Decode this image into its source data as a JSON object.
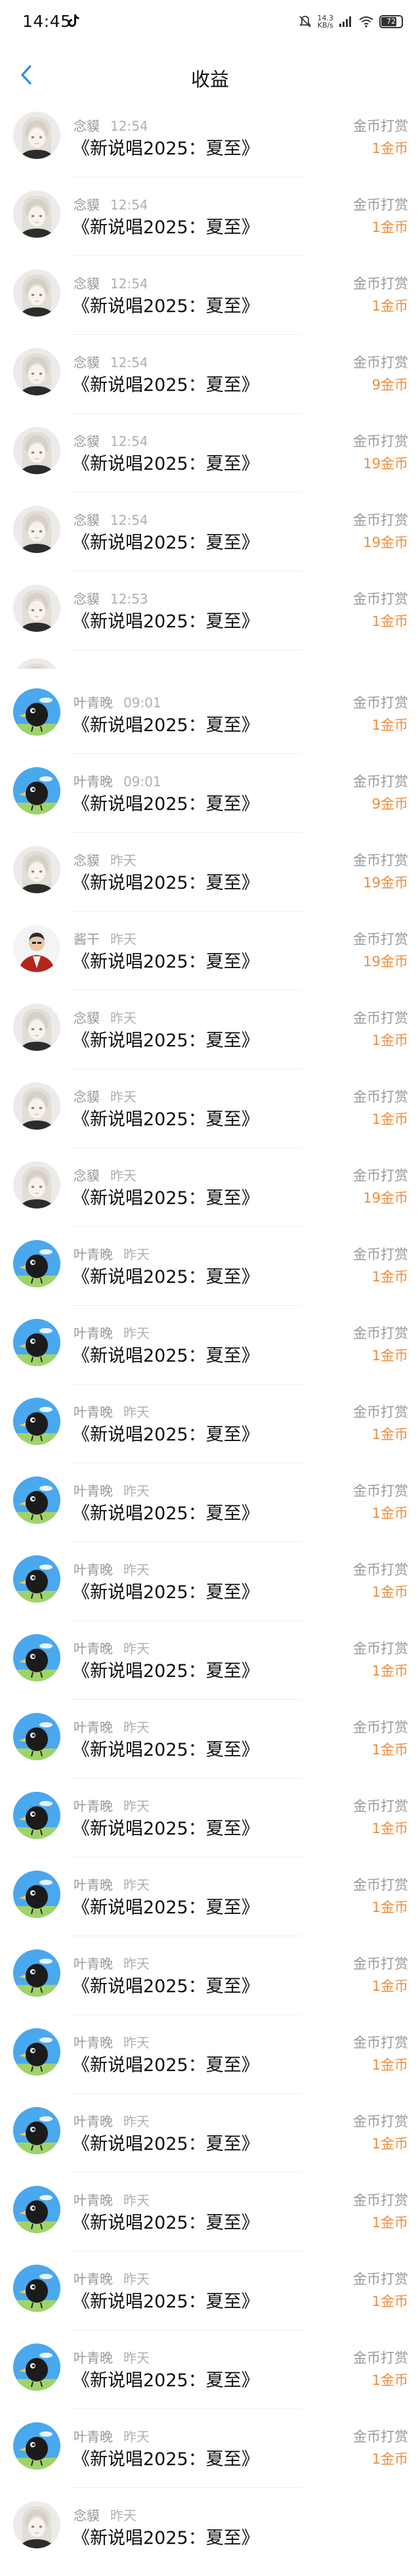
{
  "status_bar": {
    "time": "14:45",
    "net_speed": "14.3",
    "net_unit": "KB/s",
    "battery": "72"
  },
  "nav": {
    "title": "收益"
  },
  "records": [
    {
      "user": "念貘",
      "time": "12:54",
      "title": "《新说唱2025：夏至》",
      "type": "金币打赏",
      "amount": "1金币",
      "avatar": "anime"
    },
    {
      "user": "念貘",
      "time": "12:54",
      "title": "《新说唱2025：夏至》",
      "type": "金币打赏",
      "amount": "1金币",
      "avatar": "anime"
    },
    {
      "user": "念貘",
      "time": "12:54",
      "title": "《新说唱2025：夏至》",
      "type": "金币打赏",
      "amount": "1金币",
      "avatar": "anime"
    },
    {
      "user": "念貘",
      "time": "12:54",
      "title": "《新说唱2025：夏至》",
      "type": "金币打赏",
      "amount": "9金币",
      "avatar": "anime"
    },
    {
      "user": "念貘",
      "time": "12:54",
      "title": "《新说唱2025：夏至》",
      "type": "金币打赏",
      "amount": "19金币",
      "avatar": "anime"
    },
    {
      "user": "念貘",
      "time": "12:54",
      "title": "《新说唱2025：夏至》",
      "type": "金币打赏",
      "amount": "19金币",
      "avatar": "anime"
    },
    {
      "user": "念貘",
      "time": "12:53",
      "title": "《新说唱2025：夏至》",
      "type": "金币打赏",
      "amount": "1金币",
      "avatar": "anime"
    },
    {
      "user": "叶青晚",
      "time": "09:01",
      "title": "《新说唱2025：夏至》",
      "type": "金币打赏",
      "amount": "1金币",
      "avatar": "bird"
    },
    {
      "user": "叶青晚",
      "time": "09:01",
      "title": "《新说唱2025：夏至》",
      "type": "金币打赏",
      "amount": "9金币",
      "avatar": "bird"
    },
    {
      "user": "念貘",
      "time": "昨天",
      "title": "《新说唱2025：夏至》",
      "type": "金币打赏",
      "amount": "19金币",
      "avatar": "anime"
    },
    {
      "user": "酱干",
      "time": "昨天",
      "title": "《新说唱2025：夏至》",
      "type": "金币打赏",
      "amount": "19金币",
      "avatar": "person"
    },
    {
      "user": "念貘",
      "time": "昨天",
      "title": "《新说唱2025：夏至》",
      "type": "金币打赏",
      "amount": "1金币",
      "avatar": "anime"
    },
    {
      "user": "念貘",
      "time": "昨天",
      "title": "《新说唱2025：夏至》",
      "type": "金币打赏",
      "amount": "1金币",
      "avatar": "anime"
    },
    {
      "user": "念貘",
      "time": "昨天",
      "title": "《新说唱2025：夏至》",
      "type": "金币打赏",
      "amount": "19金币",
      "avatar": "anime"
    },
    {
      "user": "叶青晚",
      "time": "昨天",
      "title": "《新说唱2025：夏至》",
      "type": "金币打赏",
      "amount": "1金币",
      "avatar": "bird"
    },
    {
      "user": "叶青晚",
      "time": "昨天",
      "title": "《新说唱2025：夏至》",
      "type": "金币打赏",
      "amount": "1金币",
      "avatar": "bird"
    },
    {
      "user": "叶青晚",
      "time": "昨天",
      "title": "《新说唱2025：夏至》",
      "type": "金币打赏",
      "amount": "1金币",
      "avatar": "bird"
    },
    {
      "user": "叶青晚",
      "time": "昨天",
      "title": "《新说唱2025：夏至》",
      "type": "金币打赏",
      "amount": "1金币",
      "avatar": "bird"
    },
    {
      "user": "叶青晚",
      "time": "昨天",
      "title": "《新说唱2025：夏至》",
      "type": "金币打赏",
      "amount": "1金币",
      "avatar": "bird"
    },
    {
      "user": "叶青晚",
      "time": "昨天",
      "title": "《新说唱2025：夏至》",
      "type": "金币打赏",
      "amount": "1金币",
      "avatar": "bird"
    },
    {
      "user": "叶青晚",
      "time": "昨天",
      "title": "《新说唱2025：夏至》",
      "type": "金币打赏",
      "amount": "1金币",
      "avatar": "bird"
    },
    {
      "user": "叶青晚",
      "time": "昨天",
      "title": "《新说唱2025：夏至》",
      "type": "金币打赏",
      "amount": "1金币",
      "avatar": "bird"
    },
    {
      "user": "叶青晚",
      "time": "昨天",
      "title": "《新说唱2025：夏至》",
      "type": "金币打赏",
      "amount": "1金币",
      "avatar": "bird"
    },
    {
      "user": "叶青晚",
      "time": "昨天",
      "title": "《新说唱2025：夏至》",
      "type": "金币打赏",
      "amount": "1金币",
      "avatar": "bird"
    },
    {
      "user": "叶青晚",
      "time": "昨天",
      "title": "《新说唱2025：夏至》",
      "type": "金币打赏",
      "amount": "1金币",
      "avatar": "bird"
    },
    {
      "user": "叶青晚",
      "time": "昨天",
      "title": "《新说唱2025：夏至》",
      "type": "金币打赏",
      "amount": "1金币",
      "avatar": "bird"
    },
    {
      "user": "叶青晚",
      "time": "昨天",
      "title": "《新说唱2025：夏至》",
      "type": "金币打赏",
      "amount": "1金币",
      "avatar": "bird"
    },
    {
      "user": "叶青晚",
      "time": "昨天",
      "title": "《新说唱2025：夏至》",
      "type": "金币打赏",
      "amount": "1金币",
      "avatar": "bird"
    },
    {
      "user": "叶青晚",
      "time": "昨天",
      "title": "《新说唱2025：夏至》",
      "type": "金币打赏",
      "amount": "1金币",
      "avatar": "bird"
    },
    {
      "user": "叶青晚",
      "time": "昨天",
      "title": "《新说唱2025：夏至》",
      "type": "金币打赏",
      "amount": "1金币",
      "avatar": "bird"
    },
    {
      "user": "念貘",
      "time": "昨天",
      "title": "《新说唱2025：夏至》",
      "type": "",
      "amount": "",
      "avatar": "anime"
    }
  ],
  "colors": {
    "amount": "#f08c3a",
    "accent": "#2b8de8"
  }
}
